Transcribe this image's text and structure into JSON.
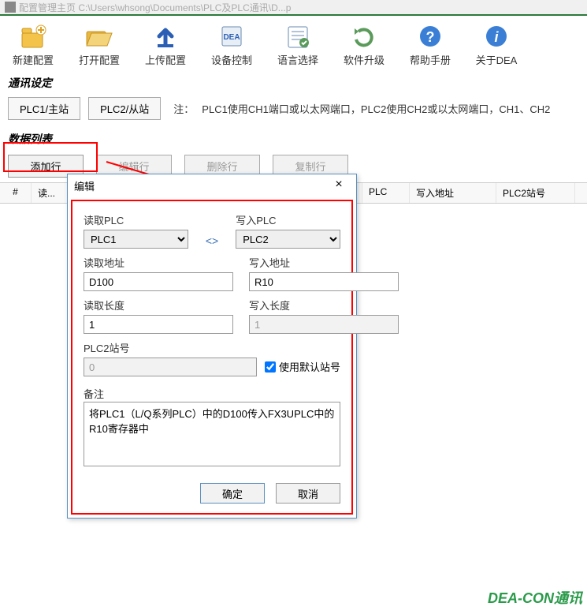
{
  "titlebar": "配置管理主页   C:\\Users\\whsong\\Documents\\PLC及PLC通讯\\D...p",
  "toolbar": [
    {
      "label": "新建配置",
      "icon": "new-config-icon"
    },
    {
      "label": "打开配置",
      "icon": "open-config-icon"
    },
    {
      "label": "上传配置",
      "icon": "upload-config-icon"
    },
    {
      "label": "设备控制",
      "icon": "device-control-icon"
    },
    {
      "label": "语言选择",
      "icon": "language-icon"
    },
    {
      "label": "软件升级",
      "icon": "update-icon"
    },
    {
      "label": "帮助手册",
      "icon": "help-icon"
    },
    {
      "label": "关于DEA",
      "icon": "about-icon"
    }
  ],
  "sections": {
    "comm": "通讯设定",
    "data": "数据列表"
  },
  "comm": {
    "btn1": "PLC1/主站",
    "btn2": "PLC2/从站",
    "note_label": "注：",
    "note": "PLC1使用CH1端口或以太网端口，PLC2使用CH2或以太网端口，CH1、CH2"
  },
  "data_toolbar": {
    "add": "添加行",
    "edit": "编辑行",
    "delete": "删除行",
    "copy": "复制行"
  },
  "table_headers": {
    "num": "#",
    "r1": "读...",
    "plc": "PLC",
    "waddr": "写入地址",
    "plc2": "PLC2站号"
  },
  "dialog": {
    "title": "编辑",
    "read_plc_label": "读取PLC",
    "read_plc_value": "PLC1",
    "write_plc_label": "写入PLC",
    "write_plc_value": "PLC2",
    "swap": "<>",
    "read_addr_label": "读取地址",
    "read_addr_value": "D100",
    "write_addr_label": "写入地址",
    "write_addr_value": "R10",
    "read_len_label": "读取长度",
    "read_len_value": "1",
    "write_len_label": "写入长度",
    "write_len_value": "1",
    "station_label": "PLC2站号",
    "station_value": "0",
    "use_default": "使用默认站号",
    "remark_label": "备注",
    "remark_value": "将PLC1（L/Q系列PLC）中的D100传入FX3UPLC中的R10寄存器中",
    "ok": "确定",
    "cancel": "取消"
  },
  "footer": "DEA-CON通讯"
}
